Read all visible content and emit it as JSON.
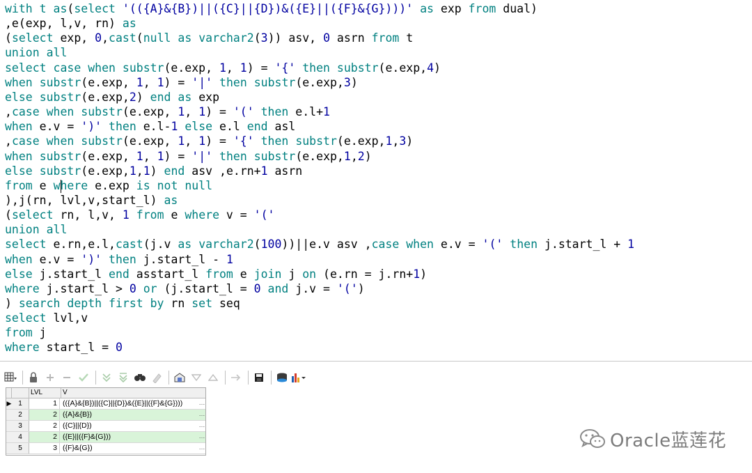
{
  "editor": {
    "lines": [
      {
        "tokens": [
          {
            "t": "with t ",
            "c": "kw"
          },
          {
            "t": "as",
            "c": "kw"
          },
          {
            "t": "(",
            "c": ""
          },
          {
            "t": "select",
            "c": "kw"
          },
          {
            "t": " ",
            "c": ""
          },
          {
            "t": "'(({A}&{B})||({C}||{D})&({E}||({F}&{G})))'",
            "c": "str"
          },
          {
            "t": " ",
            "c": ""
          },
          {
            "t": "as",
            "c": "kw"
          },
          {
            "t": " exp ",
            "c": ""
          },
          {
            "t": "from",
            "c": "kw"
          },
          {
            "t": " dual)",
            "c": ""
          }
        ]
      },
      {
        "tokens": [
          {
            "t": ",e(exp, l,v, rn) ",
            "c": ""
          },
          {
            "t": "as",
            "c": "kw"
          }
        ]
      },
      {
        "tokens": [
          {
            "t": "(",
            "c": ""
          },
          {
            "t": "select",
            "c": "kw"
          },
          {
            "t": " exp, ",
            "c": ""
          },
          {
            "t": "0",
            "c": "num"
          },
          {
            "t": ",",
            "c": ""
          },
          {
            "t": "cast",
            "c": "kw"
          },
          {
            "t": "(",
            "c": ""
          },
          {
            "t": "null",
            "c": "kw"
          },
          {
            "t": " ",
            "c": ""
          },
          {
            "t": "as",
            "c": "kw"
          },
          {
            "t": " ",
            "c": ""
          },
          {
            "t": "varchar2",
            "c": "kw"
          },
          {
            "t": "(",
            "c": ""
          },
          {
            "t": "3",
            "c": "num"
          },
          {
            "t": ")) asv, ",
            "c": ""
          },
          {
            "t": "0",
            "c": "num"
          },
          {
            "t": " asrn ",
            "c": ""
          },
          {
            "t": "from",
            "c": "kw"
          },
          {
            "t": " t",
            "c": ""
          }
        ]
      },
      {
        "tokens": [
          {
            "t": "union all",
            "c": "kw"
          }
        ]
      },
      {
        "tokens": [
          {
            "t": "select case when",
            "c": "kw"
          },
          {
            "t": " ",
            "c": ""
          },
          {
            "t": "substr",
            "c": "kw"
          },
          {
            "t": "(e.exp, ",
            "c": ""
          },
          {
            "t": "1",
            "c": "num"
          },
          {
            "t": ", ",
            "c": ""
          },
          {
            "t": "1",
            "c": "num"
          },
          {
            "t": ") = ",
            "c": ""
          },
          {
            "t": "'{'",
            "c": "str"
          },
          {
            "t": " ",
            "c": ""
          },
          {
            "t": "then",
            "c": "kw"
          },
          {
            "t": " ",
            "c": ""
          },
          {
            "t": "substr",
            "c": "kw"
          },
          {
            "t": "(e.exp,",
            "c": ""
          },
          {
            "t": "4",
            "c": "num"
          },
          {
            "t": ")",
            "c": ""
          }
        ]
      },
      {
        "tokens": [
          {
            "t": "when",
            "c": "kw"
          },
          {
            "t": " ",
            "c": ""
          },
          {
            "t": "substr",
            "c": "kw"
          },
          {
            "t": "(e.exp, ",
            "c": ""
          },
          {
            "t": "1",
            "c": "num"
          },
          {
            "t": ", ",
            "c": ""
          },
          {
            "t": "1",
            "c": "num"
          },
          {
            "t": ") = ",
            "c": ""
          },
          {
            "t": "'|'",
            "c": "str"
          },
          {
            "t": " ",
            "c": ""
          },
          {
            "t": "then",
            "c": "kw"
          },
          {
            "t": " ",
            "c": ""
          },
          {
            "t": "substr",
            "c": "kw"
          },
          {
            "t": "(e.exp,",
            "c": ""
          },
          {
            "t": "3",
            "c": "num"
          },
          {
            "t": ")",
            "c": ""
          }
        ]
      },
      {
        "tokens": [
          {
            "t": "else",
            "c": "kw"
          },
          {
            "t": " ",
            "c": ""
          },
          {
            "t": "substr",
            "c": "kw"
          },
          {
            "t": "(e.exp,",
            "c": ""
          },
          {
            "t": "2",
            "c": "num"
          },
          {
            "t": ") ",
            "c": ""
          },
          {
            "t": "end as",
            "c": "kw"
          },
          {
            "t": " exp",
            "c": ""
          }
        ]
      },
      {
        "tokens": [
          {
            "t": ",",
            "c": ""
          },
          {
            "t": "case when",
            "c": "kw"
          },
          {
            "t": " ",
            "c": ""
          },
          {
            "t": "substr",
            "c": "kw"
          },
          {
            "t": "(e.exp, ",
            "c": ""
          },
          {
            "t": "1",
            "c": "num"
          },
          {
            "t": ", ",
            "c": ""
          },
          {
            "t": "1",
            "c": "num"
          },
          {
            "t": ") = ",
            "c": ""
          },
          {
            "t": "'('",
            "c": "str"
          },
          {
            "t": " ",
            "c": ""
          },
          {
            "t": "then",
            "c": "kw"
          },
          {
            "t": " e.l+",
            "c": ""
          },
          {
            "t": "1",
            "c": "num"
          }
        ]
      },
      {
        "tokens": [
          {
            "t": "when",
            "c": "kw"
          },
          {
            "t": " e.v = ",
            "c": ""
          },
          {
            "t": "')'",
            "c": "str"
          },
          {
            "t": " ",
            "c": ""
          },
          {
            "t": "then",
            "c": "kw"
          },
          {
            "t": " e.l-",
            "c": ""
          },
          {
            "t": "1",
            "c": "num"
          },
          {
            "t": " ",
            "c": ""
          },
          {
            "t": "else",
            "c": "kw"
          },
          {
            "t": " e.l ",
            "c": ""
          },
          {
            "t": "end",
            "c": "kw"
          },
          {
            "t": " asl",
            "c": ""
          }
        ]
      },
      {
        "tokens": [
          {
            "t": ",",
            "c": ""
          },
          {
            "t": "case when",
            "c": "kw"
          },
          {
            "t": " ",
            "c": ""
          },
          {
            "t": "substr",
            "c": "kw"
          },
          {
            "t": "(e.exp, ",
            "c": ""
          },
          {
            "t": "1",
            "c": "num"
          },
          {
            "t": ", ",
            "c": ""
          },
          {
            "t": "1",
            "c": "num"
          },
          {
            "t": ") = ",
            "c": ""
          },
          {
            "t": "'{'",
            "c": "str"
          },
          {
            "t": " ",
            "c": ""
          },
          {
            "t": "then",
            "c": "kw"
          },
          {
            "t": " ",
            "c": ""
          },
          {
            "t": "substr",
            "c": "kw"
          },
          {
            "t": "(e.exp,",
            "c": ""
          },
          {
            "t": "1",
            "c": "num"
          },
          {
            "t": ",",
            "c": ""
          },
          {
            "t": "3",
            "c": "num"
          },
          {
            "t": ")",
            "c": ""
          }
        ]
      },
      {
        "tokens": [
          {
            "t": "when",
            "c": "kw"
          },
          {
            "t": " ",
            "c": ""
          },
          {
            "t": "substr",
            "c": "kw"
          },
          {
            "t": "(e.exp, ",
            "c": ""
          },
          {
            "t": "1",
            "c": "num"
          },
          {
            "t": ", ",
            "c": ""
          },
          {
            "t": "1",
            "c": "num"
          },
          {
            "t": ") = ",
            "c": ""
          },
          {
            "t": "'|'",
            "c": "str"
          },
          {
            "t": " ",
            "c": ""
          },
          {
            "t": "then",
            "c": "kw"
          },
          {
            "t": " ",
            "c": ""
          },
          {
            "t": "substr",
            "c": "kw"
          },
          {
            "t": "(e.exp,",
            "c": ""
          },
          {
            "t": "1",
            "c": "num"
          },
          {
            "t": ",",
            "c": ""
          },
          {
            "t": "2",
            "c": "num"
          },
          {
            "t": ")",
            "c": ""
          }
        ]
      },
      {
        "tokens": [
          {
            "t": "else",
            "c": "kw"
          },
          {
            "t": " ",
            "c": ""
          },
          {
            "t": "substr",
            "c": "kw"
          },
          {
            "t": "(e.exp,",
            "c": ""
          },
          {
            "t": "1",
            "c": "num"
          },
          {
            "t": ",",
            "c": ""
          },
          {
            "t": "1",
            "c": "num"
          },
          {
            "t": ") ",
            "c": ""
          },
          {
            "t": "end",
            "c": "kw"
          },
          {
            "t": " asv ,e.rn+",
            "c": ""
          },
          {
            "t": "1",
            "c": "num"
          },
          {
            "t": " asrn",
            "c": ""
          }
        ]
      },
      {
        "tokens": [
          {
            "t": "from",
            "c": "kw"
          },
          {
            "t": " e ",
            "c": ""
          },
          {
            "t": "where",
            "c": "kw"
          },
          {
            "t": " e.exp ",
            "c": ""
          },
          {
            "t": "is not null",
            "c": "kw"
          }
        ]
      },
      {
        "tokens": [
          {
            "t": "),j(rn, lvl,v,start_l) ",
            "c": ""
          },
          {
            "t": "as",
            "c": "kw"
          }
        ]
      },
      {
        "tokens": [
          {
            "t": "(",
            "c": ""
          },
          {
            "t": "select",
            "c": "kw"
          },
          {
            "t": " rn, l,v, ",
            "c": ""
          },
          {
            "t": "1",
            "c": "num"
          },
          {
            "t": " ",
            "c": ""
          },
          {
            "t": "from",
            "c": "kw"
          },
          {
            "t": " e ",
            "c": ""
          },
          {
            "t": "where",
            "c": "kw"
          },
          {
            "t": " v = ",
            "c": ""
          },
          {
            "t": "'('",
            "c": "str"
          }
        ]
      },
      {
        "tokens": [
          {
            "t": "union all",
            "c": "kw"
          }
        ]
      },
      {
        "tokens": [
          {
            "t": "select",
            "c": "kw"
          },
          {
            "t": " e.rn,e.l,",
            "c": ""
          },
          {
            "t": "cast",
            "c": "kw"
          },
          {
            "t": "(j.v ",
            "c": ""
          },
          {
            "t": "as",
            "c": "kw"
          },
          {
            "t": " ",
            "c": ""
          },
          {
            "t": "varchar2",
            "c": "kw"
          },
          {
            "t": "(",
            "c": ""
          },
          {
            "t": "100",
            "c": "num"
          },
          {
            "t": "))||e.v asv ,",
            "c": ""
          },
          {
            "t": "case when",
            "c": "kw"
          },
          {
            "t": " e.v = ",
            "c": ""
          },
          {
            "t": "'('",
            "c": "str"
          },
          {
            "t": " ",
            "c": ""
          },
          {
            "t": "then",
            "c": "kw"
          },
          {
            "t": " j.start_l + ",
            "c": ""
          },
          {
            "t": "1",
            "c": "num"
          }
        ]
      },
      {
        "tokens": [
          {
            "t": "when",
            "c": "kw"
          },
          {
            "t": " e.v = ",
            "c": ""
          },
          {
            "t": "')'",
            "c": "str"
          },
          {
            "t": " ",
            "c": ""
          },
          {
            "t": "then",
            "c": "kw"
          },
          {
            "t": " j.start_l - ",
            "c": ""
          },
          {
            "t": "1",
            "c": "num"
          }
        ]
      },
      {
        "tokens": [
          {
            "t": "else",
            "c": "kw"
          },
          {
            "t": " j.start_l ",
            "c": ""
          },
          {
            "t": "end",
            "c": "kw"
          },
          {
            "t": " asstart_l ",
            "c": ""
          },
          {
            "t": "from",
            "c": "kw"
          },
          {
            "t": " e ",
            "c": ""
          },
          {
            "t": "join",
            "c": "kw"
          },
          {
            "t": " j ",
            "c": ""
          },
          {
            "t": "on",
            "c": "kw"
          },
          {
            "t": " (e.rn = j.rn+",
            "c": ""
          },
          {
            "t": "1",
            "c": "num"
          },
          {
            "t": ")",
            "c": ""
          }
        ]
      },
      {
        "tokens": [
          {
            "t": "where",
            "c": "kw"
          },
          {
            "t": " j.start_l > ",
            "c": ""
          },
          {
            "t": "0",
            "c": "num"
          },
          {
            "t": " ",
            "c": ""
          },
          {
            "t": "or",
            "c": "kw"
          },
          {
            "t": " (j.start_l = ",
            "c": ""
          },
          {
            "t": "0",
            "c": "num"
          },
          {
            "t": " ",
            "c": ""
          },
          {
            "t": "and",
            "c": "kw"
          },
          {
            "t": " j.v = ",
            "c": ""
          },
          {
            "t": "'('",
            "c": "str"
          },
          {
            "t": ")",
            "c": ""
          }
        ]
      },
      {
        "tokens": [
          {
            "t": ") ",
            "c": ""
          },
          {
            "t": "search depth first by",
            "c": "kw"
          },
          {
            "t": " rn ",
            "c": ""
          },
          {
            "t": "set",
            "c": "kw"
          },
          {
            "t": " seq",
            "c": ""
          }
        ]
      },
      {
        "tokens": [
          {
            "t": "select",
            "c": "kw"
          },
          {
            "t": " lvl,v",
            "c": ""
          }
        ]
      },
      {
        "tokens": [
          {
            "t": "from",
            "c": "kw"
          },
          {
            "t": " j",
            "c": ""
          }
        ]
      },
      {
        "tokens": [
          {
            "t": "where",
            "c": "kw"
          },
          {
            "t": " start_l = ",
            "c": ""
          },
          {
            "t": "0",
            "c": "num"
          }
        ]
      }
    ]
  },
  "toolbar": {
    "icons": [
      "grid-options-icon",
      "lock-icon",
      "add-record-icon",
      "delete-record-icon",
      "post-changes-icon",
      "next-record-icon",
      "last-record-icon",
      "find-icon",
      "clear-icon",
      "query-by-example-icon",
      "filter-icon",
      "sort-icon",
      "export-icon",
      "save-icon",
      "print-icon",
      "chart-icon"
    ]
  },
  "grid": {
    "columns": [
      "LVL",
      "V"
    ],
    "rows": [
      {
        "num": "1",
        "lvl": "1",
        "v": "(({A}&{B})||({C}||{D})&({E}||({F}&{G})))",
        "current": true
      },
      {
        "num": "2",
        "lvl": "2",
        "v": "({A}&{B})",
        "current": false
      },
      {
        "num": "3",
        "lvl": "2",
        "v": "({C}||{D})",
        "current": false
      },
      {
        "num": "4",
        "lvl": "2",
        "v": "({E}||({F}&{G}))",
        "current": false
      },
      {
        "num": "5",
        "lvl": "3",
        "v": "({F}&{G})",
        "current": false
      }
    ],
    "cell_button": "…",
    "current_marker": "▶",
    "alt_row_color": "#d9f4d9"
  },
  "watermark": {
    "text": "Oracle蓝莲花"
  },
  "colors": {
    "keyword": "#008080",
    "string": "#0000a0",
    "text": "#000000"
  }
}
